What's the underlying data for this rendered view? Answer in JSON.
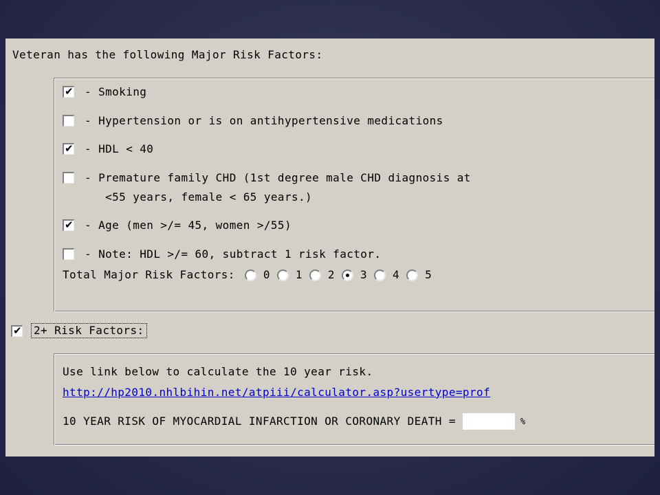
{
  "header": {
    "title": "Veteran has the following Major Risk Factors:"
  },
  "risk_factors": [
    {
      "label": "- Smoking",
      "checked": true
    },
    {
      "label": "- Hypertension or is on antihypertensive medications",
      "checked": false
    },
    {
      "label": "- HDL < 40",
      "checked": true
    },
    {
      "label": "- Premature family CHD (1st degree male CHD diagnosis at\n   <55 years, female < 65 years.)",
      "checked": false
    },
    {
      "label": "- Age (men >/= 45, women >/55)",
      "checked": true
    },
    {
      "label": "- Note: HDL >/= 60, subtract 1 risk factor.",
      "checked": false
    }
  ],
  "total": {
    "label": "Total Major Risk Factors:",
    "options": [
      "0",
      "1",
      "2",
      "3",
      "4",
      "5"
    ],
    "selected": "3"
  },
  "two_plus": {
    "label": "2+ Risk Factors:",
    "checked": true
  },
  "calculator": {
    "instruction": "Use link below to calculate the 10 year risk.",
    "link_text": "http://hp2010.nhlbihin.net/atpiii/calculator.asp?usertype=prof",
    "result_label": "10 YEAR RISK OF MYOCARDIAL INFARCTION OR CORONARY DEATH =",
    "result_value": "",
    "unit": "%"
  }
}
